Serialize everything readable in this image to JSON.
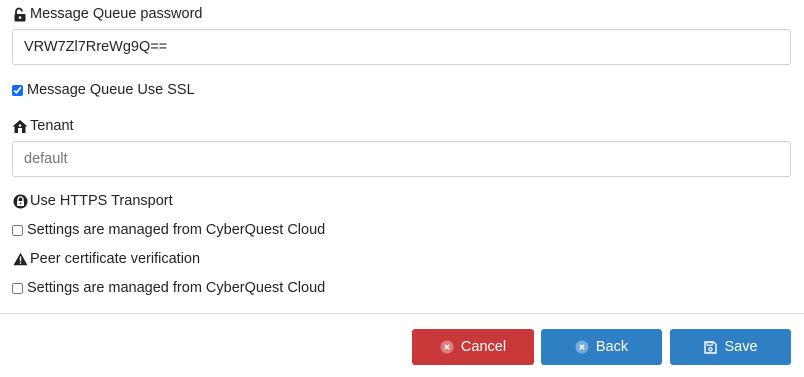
{
  "fields": {
    "mq_password": {
      "label": "Message Queue password",
      "value": "VRW7Zl7RreWg9Q=="
    },
    "mq_ssl": {
      "label": "Message Queue Use SSL",
      "checked": true
    },
    "tenant": {
      "label": "Tenant",
      "placeholder": "default"
    },
    "https": {
      "label": "Use HTTPS Transport",
      "managed_label": "Settings are managed from CyberQuest Cloud",
      "checked": false
    },
    "peer_cert": {
      "label": "Peer certificate verification",
      "managed_label": "Settings are managed from CyberQuest Cloud",
      "checked": false
    }
  },
  "buttons": {
    "cancel": {
      "label": "Cancel",
      "icon": "circle-x-icon",
      "color": "#c9393a"
    },
    "back": {
      "label": "Back",
      "icon": "circle-x-icon",
      "color": "#2f7fc4"
    },
    "save": {
      "label": "Save",
      "icon": "floppy-disk-icon",
      "color": "#2f7fc4"
    }
  },
  "icons": {
    "password": "unlock-icon",
    "tenant": "house-icon",
    "https": "lock-circle-icon",
    "peer_cert": "warning-triangle-icon"
  }
}
